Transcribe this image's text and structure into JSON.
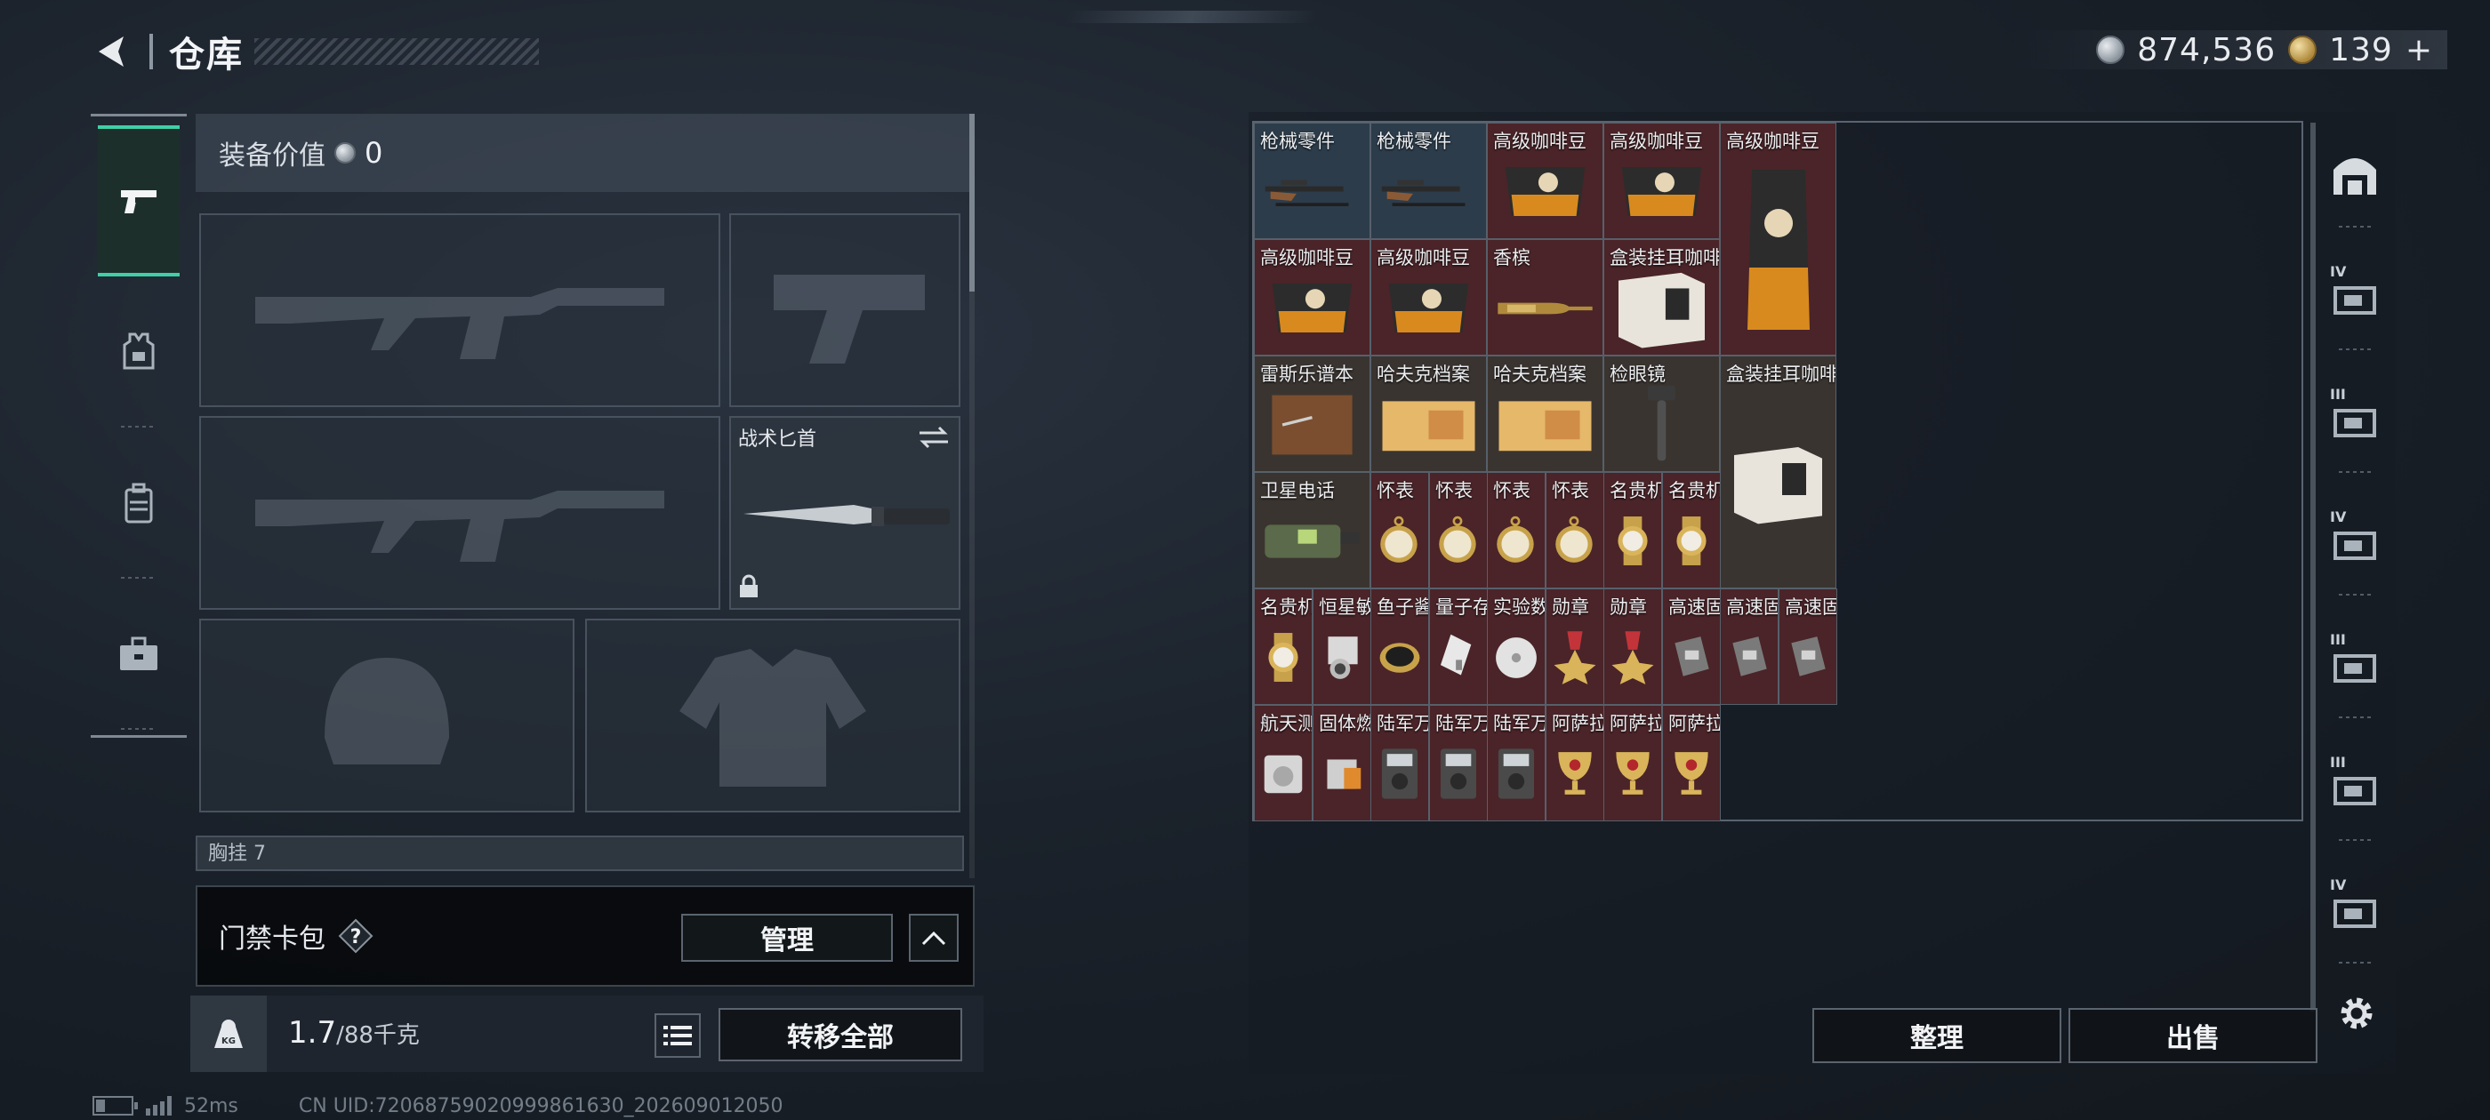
{
  "header": {
    "title": "仓库"
  },
  "currency": {
    "silver": "874,536",
    "gold": "139",
    "gold_plus": "+"
  },
  "equipment": {
    "value_label": "装备价值",
    "value": "0",
    "knife_label": "战术匕首",
    "chest_label": "胸挂 7"
  },
  "card_bag": {
    "label": "门禁卡包",
    "help": "?",
    "manage": "管理"
  },
  "weight": {
    "current": "1.7",
    "max": "/88千克",
    "kg_badge": "KG",
    "transfer_all": "转移全部"
  },
  "status": {
    "ping": "52ms",
    "uid": "CN UID:72068759020999861630_202609012050"
  },
  "storage": {
    "items": [
      {
        "label": "枪械零件",
        "bg": "blue",
        "icon": "rifle-parts-icon"
      },
      {
        "label": "枪械零件",
        "bg": "blue",
        "icon": "rifle-parts-icon"
      },
      {
        "label": "高级咖啡豆",
        "bg": "red",
        "icon": "coffee-bag-icon"
      },
      {
        "label": "高级咖啡豆",
        "bg": "red",
        "icon": "coffee-bag-icon"
      },
      {
        "label": "高级咖啡豆",
        "bg": "red",
        "icon": "coffee-bag-tall-icon"
      },
      {
        "label": "高级咖啡豆",
        "bg": "red",
        "icon": "coffee-bag-icon"
      },
      {
        "label": "高级咖啡豆",
        "bg": "red",
        "icon": "coffee-bag-icon"
      },
      {
        "label": "香槟",
        "bg": "red",
        "icon": "champagne-icon"
      },
      {
        "label": "盒装挂耳咖啡",
        "bg": "red",
        "icon": "coffee-box-icon"
      },
      {
        "label": "盒装挂耳咖啡",
        "bg": "brown",
        "icon": "coffee-box-icon"
      },
      {
        "label": "雷斯乐谱本",
        "bg": "brown",
        "icon": "notebook-icon"
      },
      {
        "label": "哈夫克档案",
        "bg": "brown",
        "icon": "folder-icon"
      },
      {
        "label": "哈夫克档案",
        "bg": "brown",
        "icon": "folder-icon"
      },
      {
        "label": "检眼镜",
        "bg": "brown",
        "icon": "ophthalmoscope-icon"
      },
      {
        "label": "卫星电话",
        "bg": "brown",
        "icon": "sat-phone-icon"
      },
      {
        "label": "怀表",
        "bg": "red",
        "icon": "pocket-watch-icon"
      },
      {
        "label": "怀表",
        "bg": "red",
        "icon": "pocket-watch-icon"
      },
      {
        "label": "怀表",
        "bg": "red",
        "icon": "pocket-watch-icon"
      },
      {
        "label": "怀表",
        "bg": "red",
        "icon": "pocket-watch-icon"
      },
      {
        "label": "名贵机械表",
        "bg": "red",
        "icon": "wristwatch-icon"
      },
      {
        "label": "名贵机械表",
        "bg": "red",
        "icon": "wristwatch-icon"
      },
      {
        "label": "名贵机械表",
        "bg": "red",
        "icon": "wristwatch-icon"
      },
      {
        "label": "恒星敏感器",
        "bg": "red",
        "icon": "star-sensor-icon"
      },
      {
        "label": "鱼子酱",
        "bg": "red",
        "icon": "caviar-icon"
      },
      {
        "label": "量子存储",
        "bg": "red",
        "icon": "usb-drive-icon"
      },
      {
        "label": "实验数据",
        "bg": "red",
        "icon": "disc-icon"
      },
      {
        "label": "勋章",
        "bg": "red",
        "icon": "medal-icon"
      },
      {
        "label": "勋章",
        "bg": "red",
        "icon": "medal-icon"
      },
      {
        "label": "高速固态…",
        "bg": "red",
        "icon": "ssd-icon"
      },
      {
        "label": "高速固态…",
        "bg": "red",
        "icon": "ssd-icon"
      },
      {
        "label": "高速固态…",
        "bg": "red",
        "icon": "ssd-icon"
      },
      {
        "label": "航天测试…",
        "bg": "red",
        "icon": "aerospace-device-icon"
      },
      {
        "label": "固体燃料",
        "bg": "red",
        "icon": "fuel-icon"
      },
      {
        "label": "陆军万用表",
        "bg": "red",
        "icon": "multimeter-icon"
      },
      {
        "label": "陆军万用表",
        "bg": "red",
        "icon": "multimeter-icon"
      },
      {
        "label": "陆军万用表",
        "bg": "red",
        "icon": "multimeter-icon"
      },
      {
        "label": "阿萨拉酒杯",
        "bg": "red",
        "icon": "goblet-icon"
      },
      {
        "label": "阿萨拉酒杯",
        "bg": "red",
        "icon": "goblet-icon"
      },
      {
        "label": "阿萨拉酒杯",
        "bg": "red",
        "icon": "goblet-icon"
      }
    ],
    "sort": "整理",
    "sell": "出售"
  },
  "side_tabs": [
    "IV",
    "III",
    "IV",
    "III",
    "III",
    "IV"
  ],
  "colors": {
    "accent": "#3fd0a7",
    "cell_red": "#4a2428",
    "cell_blue": "#2c3c4a",
    "cell_brown": "#3a3430"
  }
}
